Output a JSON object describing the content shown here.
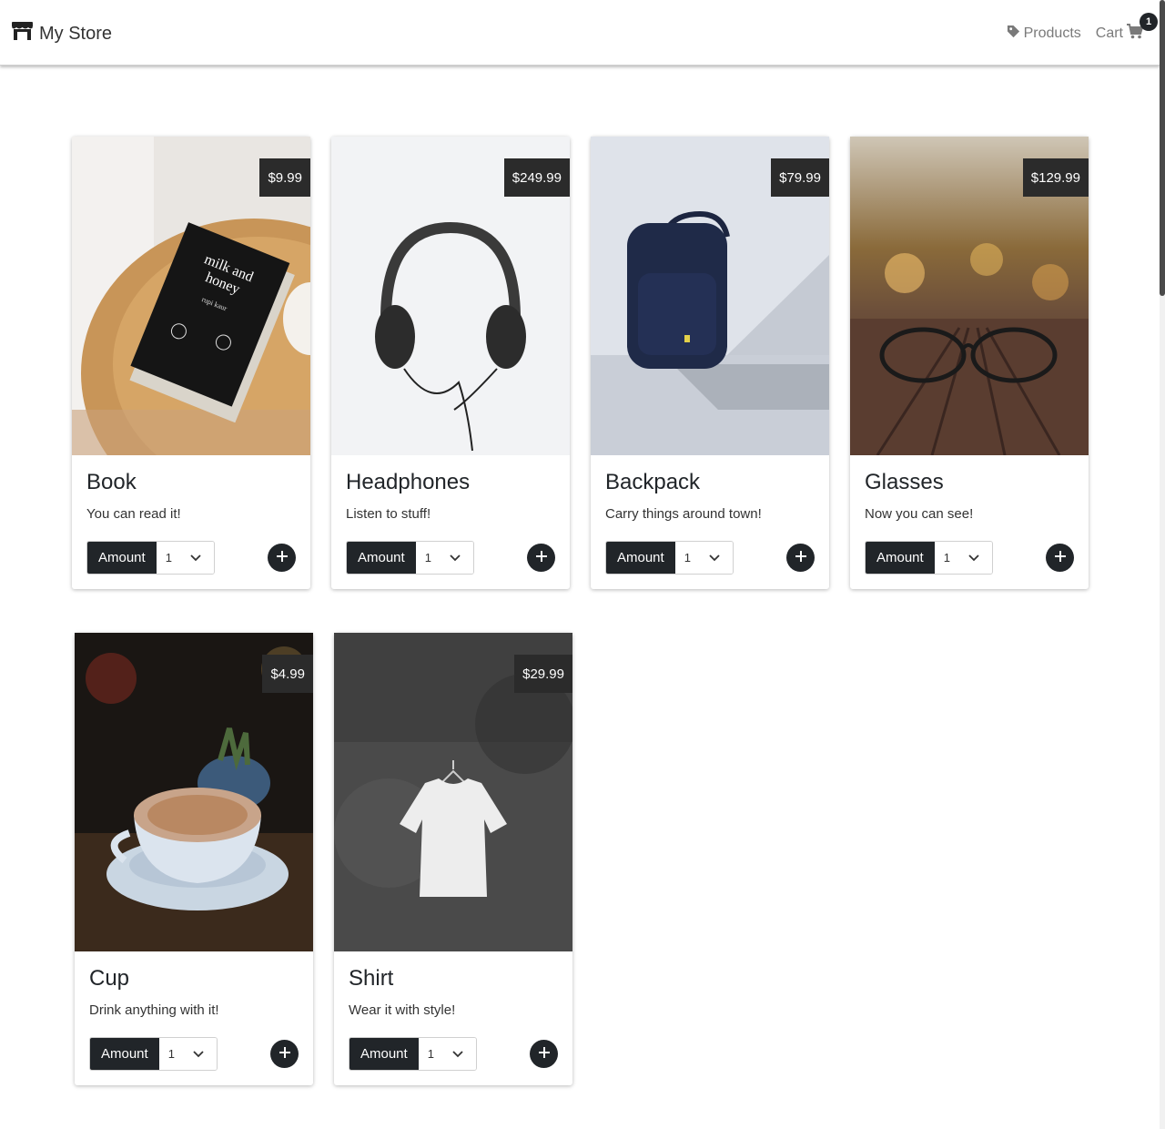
{
  "navbar": {
    "brand": "My Store",
    "products_label": "Products",
    "cart_label": "Cart",
    "cart_count": "1",
    "icons": {
      "brand": "store-icon",
      "products": "tag-icon",
      "cart": "shopping-cart-icon"
    }
  },
  "products": [
    {
      "name": "Book",
      "description": "You can read it!",
      "price": "$9.99",
      "amount_label": "Amount",
      "amount_value": "1"
    },
    {
      "name": "Headphones",
      "description": "Listen to stuff!",
      "price": "$249.99",
      "amount_label": "Amount",
      "amount_value": "1"
    },
    {
      "name": "Backpack",
      "description": "Carry things around town!",
      "price": "$79.99",
      "amount_label": "Amount",
      "amount_value": "1"
    },
    {
      "name": "Glasses",
      "description": "Now you can see!",
      "price": "$129.99",
      "amount_label": "Amount",
      "amount_value": "1"
    },
    {
      "name": "Cup",
      "description": "Drink anything with it!",
      "price": "$4.99",
      "amount_label": "Amount",
      "amount_value": "1"
    },
    {
      "name": "Shirt",
      "description": "Wear it with style!",
      "price": "$29.99",
      "amount_label": "Amount",
      "amount_value": "1"
    }
  ],
  "colors": {
    "dark": "#212529",
    "price_bg": "#2b2b2b",
    "nav_text": "#7a7a7a"
  }
}
